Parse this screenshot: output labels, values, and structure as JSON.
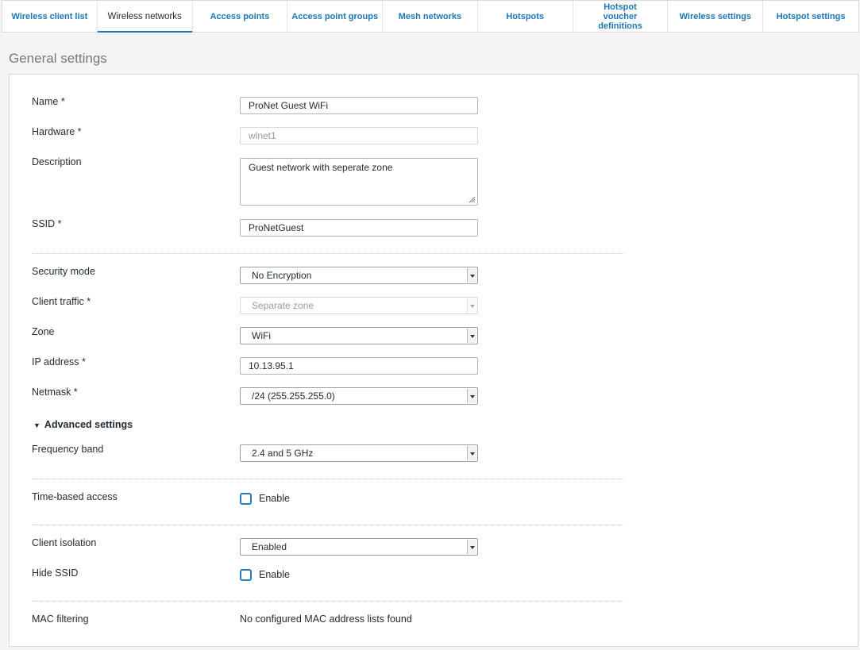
{
  "tabs": [
    {
      "label": "Wireless client list",
      "active": false
    },
    {
      "label": "Wireless networks",
      "active": true
    },
    {
      "label": "Access points",
      "active": false
    },
    {
      "label": "Access point groups",
      "active": false
    },
    {
      "label": "Mesh networks",
      "active": false
    },
    {
      "label": "Hotspots",
      "active": false
    },
    {
      "label": "Hotspot voucher definitions",
      "active": false
    },
    {
      "label": "Wireless settings",
      "active": false
    },
    {
      "label": "Hotspot settings",
      "active": false
    }
  ],
  "section_title": "General settings",
  "form": {
    "name": {
      "label": "Name *",
      "value": "ProNet Guest WiFi"
    },
    "hardware": {
      "label": "Hardware *",
      "value": "wlnet1"
    },
    "description": {
      "label": "Description",
      "value": "Guest network with seperate zone"
    },
    "ssid": {
      "label": "SSID *",
      "value": "ProNetGuest"
    },
    "security_mode": {
      "label": "Security mode",
      "value": "No Encryption"
    },
    "client_traffic": {
      "label": "Client traffic *",
      "value": "Separate zone"
    },
    "zone": {
      "label": "Zone",
      "value": "WiFi"
    },
    "ip_address": {
      "label": "IP address *",
      "value": "10.13.95.1"
    },
    "netmask": {
      "label": "Netmask *",
      "value": "/24 (255.255.255.0)"
    },
    "advanced_settings": {
      "label": "Advanced settings",
      "arrow": "▼"
    },
    "frequency_band": {
      "label": "Frequency band",
      "value": "2.4 and 5 GHz"
    },
    "time_based_access": {
      "label": "Time-based access",
      "checkbox_label": "Enable",
      "checked": false
    },
    "client_isolation": {
      "label": "Client isolation",
      "value": "Enabled"
    },
    "hide_ssid": {
      "label": "Hide SSID",
      "checkbox_label": "Enable",
      "checked": false
    },
    "mac_filtering": {
      "label": "MAC filtering",
      "value": "No configured MAC address lists found"
    }
  },
  "colors": {
    "accent": "#1b77b6",
    "checkbox_border": "#2a7cc0"
  }
}
